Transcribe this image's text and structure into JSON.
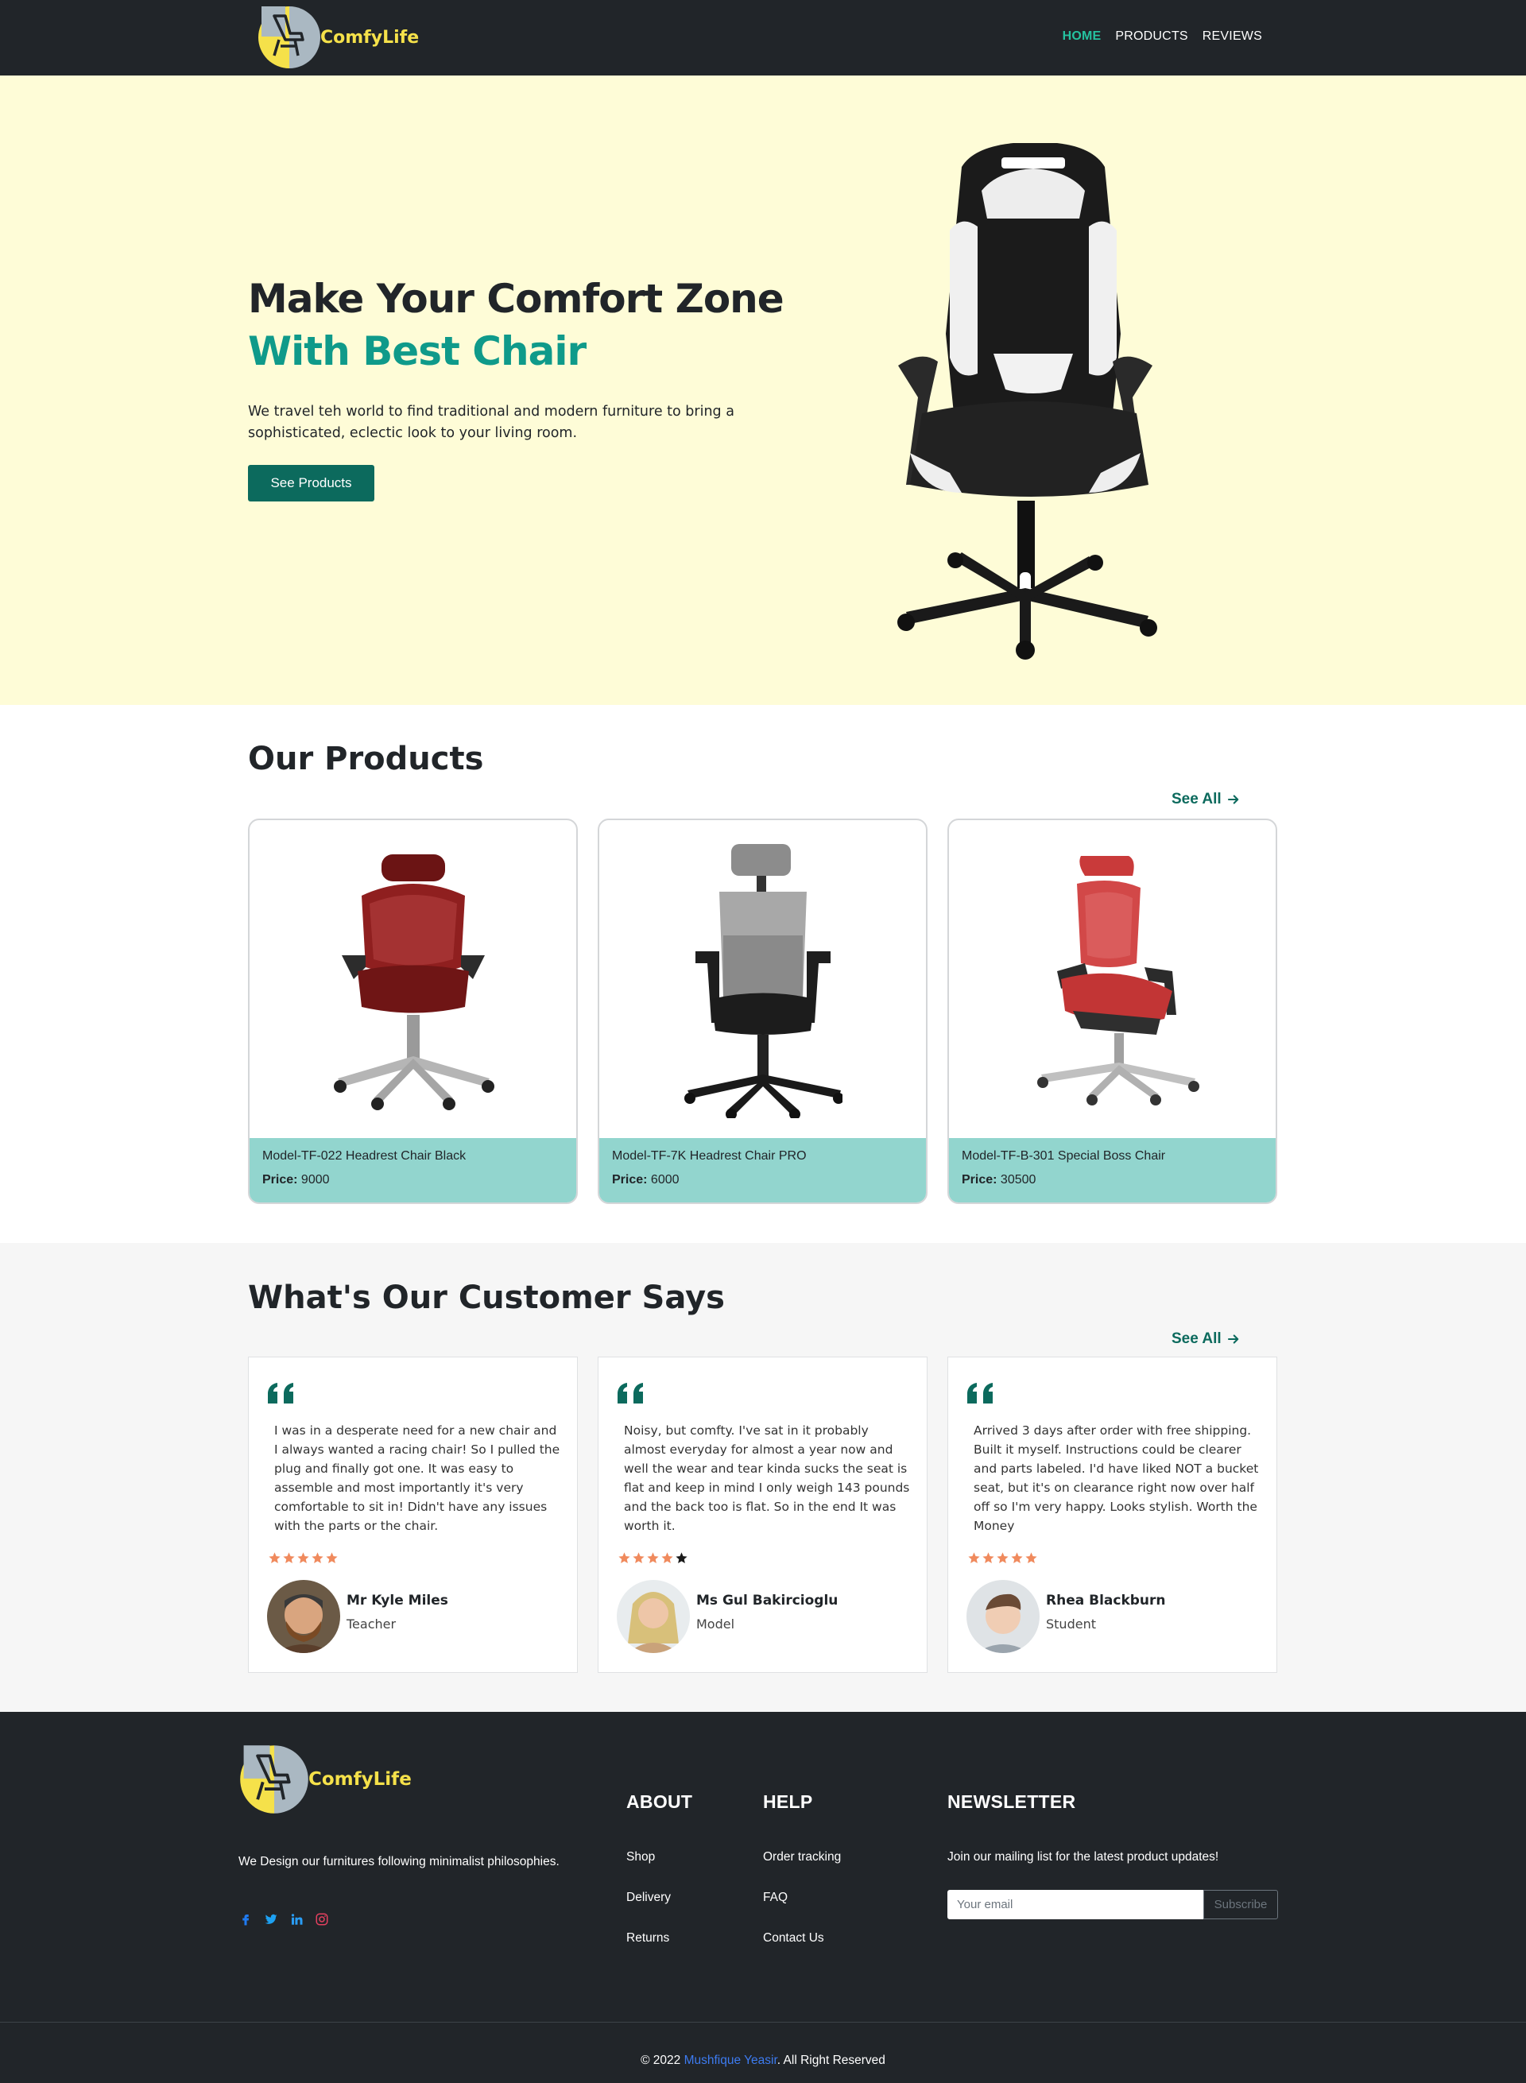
{
  "brand": {
    "name": "ComfyLife"
  },
  "nav": {
    "items": [
      {
        "label": "HOME",
        "active": true
      },
      {
        "label": "PRODUCTS",
        "active": false
      },
      {
        "label": "REVIEWS",
        "active": false
      }
    ]
  },
  "hero": {
    "title_line1": "Make Your Comfort Zone",
    "title_line2": "With Best Chair",
    "description": "We travel teh world to find traditional and modern furniture to bring a sophisticated, eclectic look to your living room.",
    "button_label": "See Products"
  },
  "products": {
    "title": "Our Products",
    "see_all": "See All",
    "items": [
      {
        "name": "Model-TF-022 Headrest Chair Black",
        "price_label": "Price:",
        "price": "9000"
      },
      {
        "name": "Model-TF-7K Headrest Chair PRO",
        "price_label": "Price:",
        "price": "6000"
      },
      {
        "name": "Model-TF-B-301 Special Boss Chair",
        "price_label": "Price:",
        "price": "30500"
      }
    ]
  },
  "reviews": {
    "title": "What's Our Customer Says",
    "see_all": "See All",
    "items": [
      {
        "text": "I was in a desperate need for a new chair and I always wanted a racing chair! So I pulled the plug and finally got one. It was easy to assemble and most importantly it's very comfortable to sit in! Didn't have any issues with the parts or the chair.",
        "rating": 5,
        "name": "Mr Kyle Miles",
        "role": "Teacher"
      },
      {
        "text": "Noisy, but comfty. I've sat in it probably almost everyday for almost a year now and well the wear and tear kinda sucks the seat is flat and keep in mind I only weigh 143 pounds and the back too is flat. So in the end It was worth it.",
        "rating": 4,
        "name": "Ms Gul Bakircioglu",
        "role": "Model"
      },
      {
        "text": "Arrived 3 days after order with free shipping. Built it myself. Instructions could be clearer and parts labeled. I'd have liked NOT a bucket seat, but it's on clearance right now over half off so I'm very happy. Looks stylish. Worth the Money",
        "rating": 5,
        "name": "Rhea Blackburn",
        "role": "Student"
      }
    ]
  },
  "footer": {
    "brand_name": "ComfyLife",
    "tagline": "We Design our furnitures following minimalist philosophies.",
    "socials": [
      "facebook-icon",
      "twitter-icon",
      "linkedin-icon",
      "instagram-icon"
    ],
    "about": {
      "heading": "ABOUT",
      "links": [
        "Shop",
        "Delivery",
        "Returns"
      ]
    },
    "help": {
      "heading": "HELP",
      "links": [
        "Order tracking",
        "FAQ",
        "Contact Us"
      ]
    },
    "newsletter": {
      "heading": "NEWSLETTER",
      "text": "Join our mailing list for the latest product updates!",
      "placeholder": "Your email",
      "button_label": "Subscribe"
    },
    "copyright_prefix": "© 2022",
    "copyright_author": "Mushfique Yeasir",
    "copyright_suffix": ". All Right Reserved"
  },
  "colors": {
    "nav_bg": "#212529",
    "brand_yellow": "#f5e14a",
    "accent_teal": "#0f9a8a",
    "button_green": "#0c6a5d",
    "hero_bg": "#fefcd7",
    "card_info_bg": "#92d5ce",
    "star_orange": "#f08a5d"
  }
}
